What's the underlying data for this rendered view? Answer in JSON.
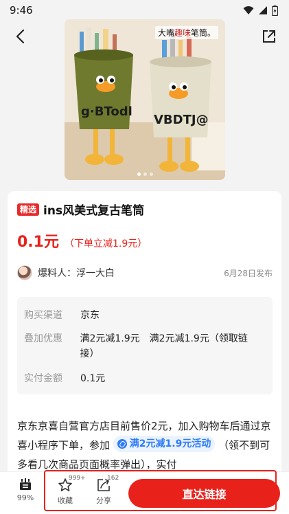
{
  "status": {
    "time": "9:46",
    "icons": [
      "wifi-icon",
      "cellular-signal-icon",
      "battery-icon"
    ]
  },
  "nav": {
    "back_icon": "back-arrow-icon",
    "share_icon": "external-share-icon"
  },
  "hero": {
    "caption_prefix": "大嘴",
    "caption_accent": "趣味",
    "caption_suffix": "笔筒。"
  },
  "product": {
    "tag": "精选",
    "title": "ins风美式复古笔筒",
    "price": "0.1元",
    "price_note": "（下单立减1.9元）"
  },
  "author": {
    "label": "爆料人：浮一大白",
    "date": "6月28日发布"
  },
  "info": {
    "channel_key": "购买渠道",
    "channel_val": "京东",
    "discount_key": "叠加优惠",
    "discount_val": "满2元减1.9元　满2元减1.9元（领取链接）",
    "paid_key": "实付金额",
    "paid_val": "0.1元"
  },
  "description": {
    "text_before": "京东京喜自营官方店目前售价2元，加入购物车后通过京喜小程序下单，参加",
    "promo": "满2元减1.9元活动",
    "text_after": "（领不到可多看几次商品页面概率弹出），实付"
  },
  "bottom": {
    "save_pct": "99%",
    "fav_label": "收藏",
    "fav_count": "999+",
    "share_label": "分享",
    "share_count": "162",
    "buy_label": "直达链接"
  },
  "colors": {
    "accent_red": "#e8221b",
    "promo_blue": "#2e7bf6"
  }
}
